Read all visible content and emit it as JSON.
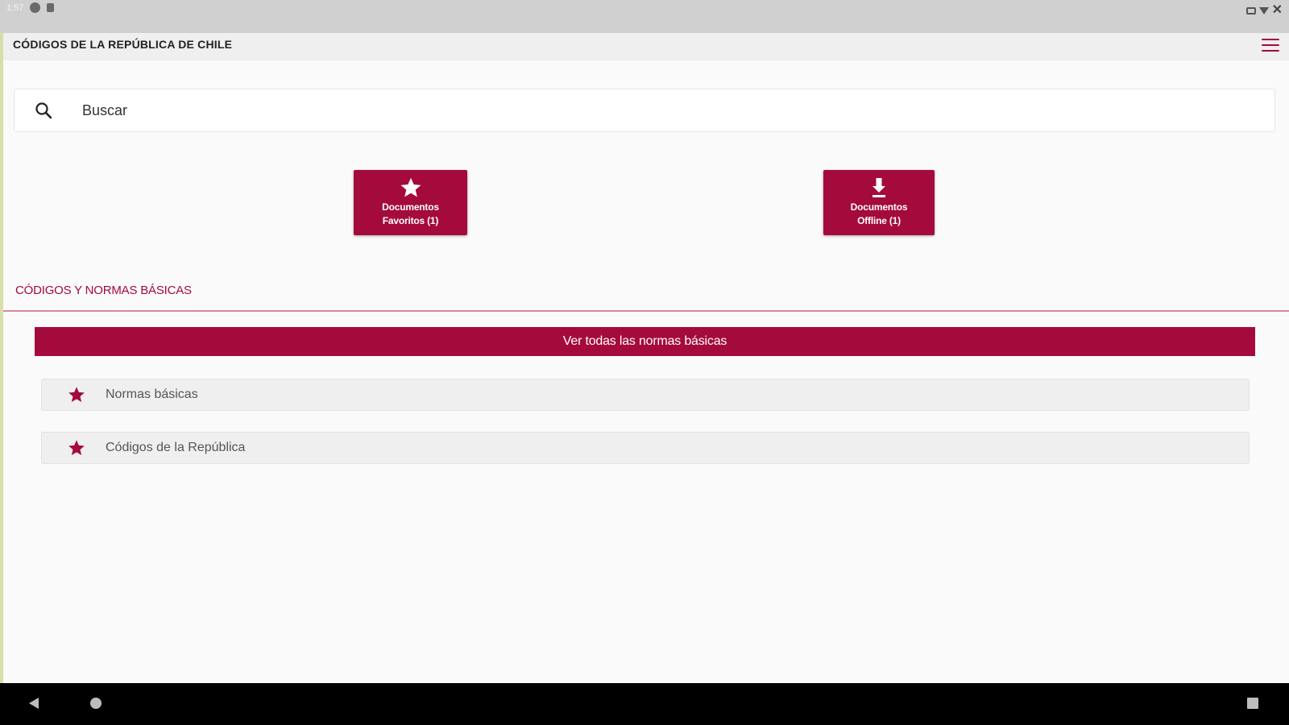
{
  "status_bar": {
    "time": "1:57",
    "icons": [
      "sync-icon",
      "sd-card-icon",
      "battery-icon",
      "wifi-icon",
      "signal-off-icon"
    ]
  },
  "app_bar": {
    "title": "CÓDIGOS DE LA REPÚBLICA DE CHILE",
    "menu_icon": "hamburger-menu-icon"
  },
  "search": {
    "placeholder": "Buscar",
    "icon": "search-icon"
  },
  "quick_actions": [
    {
      "icon": "star-icon",
      "line1": "Documentos",
      "line2": "Favoritos (1)"
    },
    {
      "icon": "download-icon",
      "line1": "Documentos",
      "line2": "Offline (1)"
    }
  ],
  "section": {
    "title": "CÓDIGOS Y NORMAS BÁSICAS",
    "see_all_label": "Ver todas las normas básicas",
    "items": [
      {
        "icon": "star-icon",
        "label": "Normas básicas"
      },
      {
        "icon": "star-icon",
        "label": "Códigos de la República"
      }
    ]
  },
  "nav_bar": {
    "icons": [
      "back-icon",
      "home-icon",
      "recents-icon"
    ]
  },
  "colors": {
    "accent": "#a50a3c",
    "app_bar_bg": "#efefef",
    "page_bg": "#fafafa",
    "status_bar_bg": "#d0d0d0",
    "nav_bar_bg": "#000000"
  }
}
